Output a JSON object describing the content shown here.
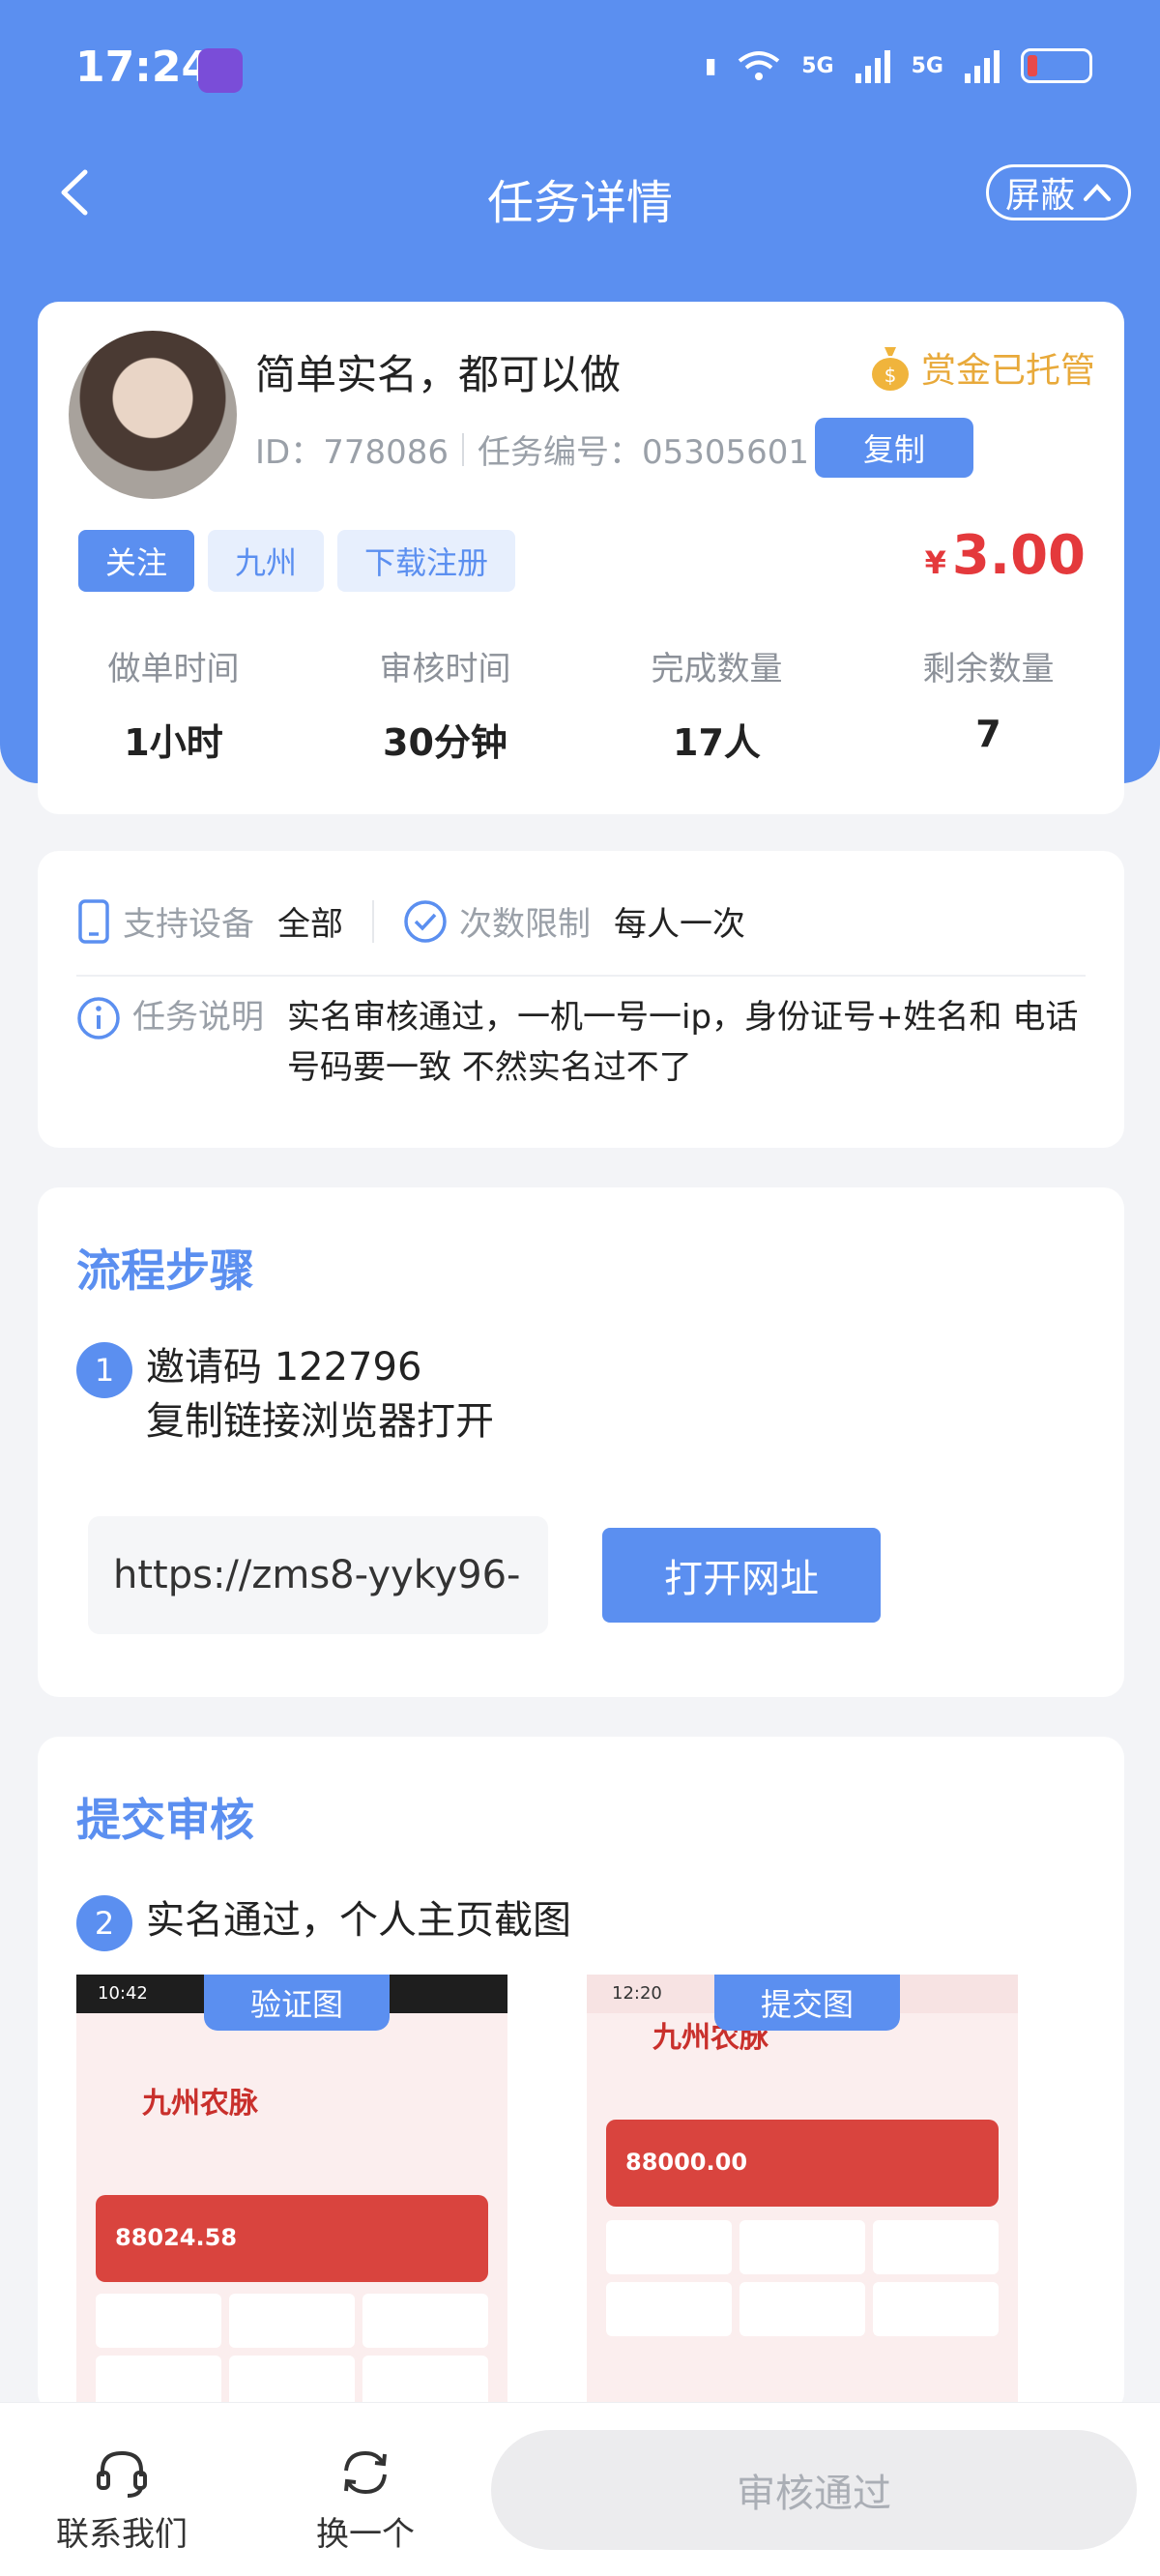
{
  "status_bar": {
    "time": "17:24",
    "network_1": "5G",
    "network_2": "5G"
  },
  "nav": {
    "title": "任务详情",
    "block_label": "屏蔽"
  },
  "task": {
    "title": "简单实名，都可以做",
    "escrow": "赏金已托管",
    "id_text": "ID：778086",
    "number_text": "任务编号：05305601",
    "copy_label": "复制",
    "tags": [
      "关注",
      "九州",
      "下载注册"
    ],
    "currency": "¥",
    "price": "3.00",
    "stats": [
      {
        "label": "做单时间",
        "value": "1小时"
      },
      {
        "label": "审核时间",
        "value": "30分钟"
      },
      {
        "label": "完成数量",
        "value": "17人"
      },
      {
        "label": "剩余数量",
        "value": "7"
      }
    ]
  },
  "info": {
    "device_label": "支持设备",
    "device_value": "全部",
    "limit_label": "次数限制",
    "limit_value": "每人一次",
    "desc_label": "任务说明",
    "desc_value": "实名审核通过，一机一号一ip，身份证号+姓名和 电话号码要一致 不然实名过不了"
  },
  "steps": {
    "title": "流程步骤",
    "step1_num": "1",
    "step1_line1": "邀请码 122796",
    "step1_line2": "复制链接浏览器打开",
    "url": "https://zms8-yyky96-",
    "open_label": "打开网址"
  },
  "submit": {
    "title": "提交审核",
    "step2_num": "2",
    "step2_text": "实名通过，个人主页截图",
    "verify_label": "验证图",
    "submit_label": "提交图",
    "shot1": {
      "time": "10:42",
      "brand": "九州农脉",
      "amount": "88024.58"
    },
    "shot2": {
      "time": "12:20",
      "brand": "九州农脉",
      "amount": "88000.00"
    }
  },
  "bottom": {
    "contact": "联系我们",
    "switch": "换一个",
    "approve": "审核通过"
  },
  "colors": {
    "primary": "#5b8ff0",
    "price": "#e4393c",
    "escrow": "#e8a93a"
  }
}
